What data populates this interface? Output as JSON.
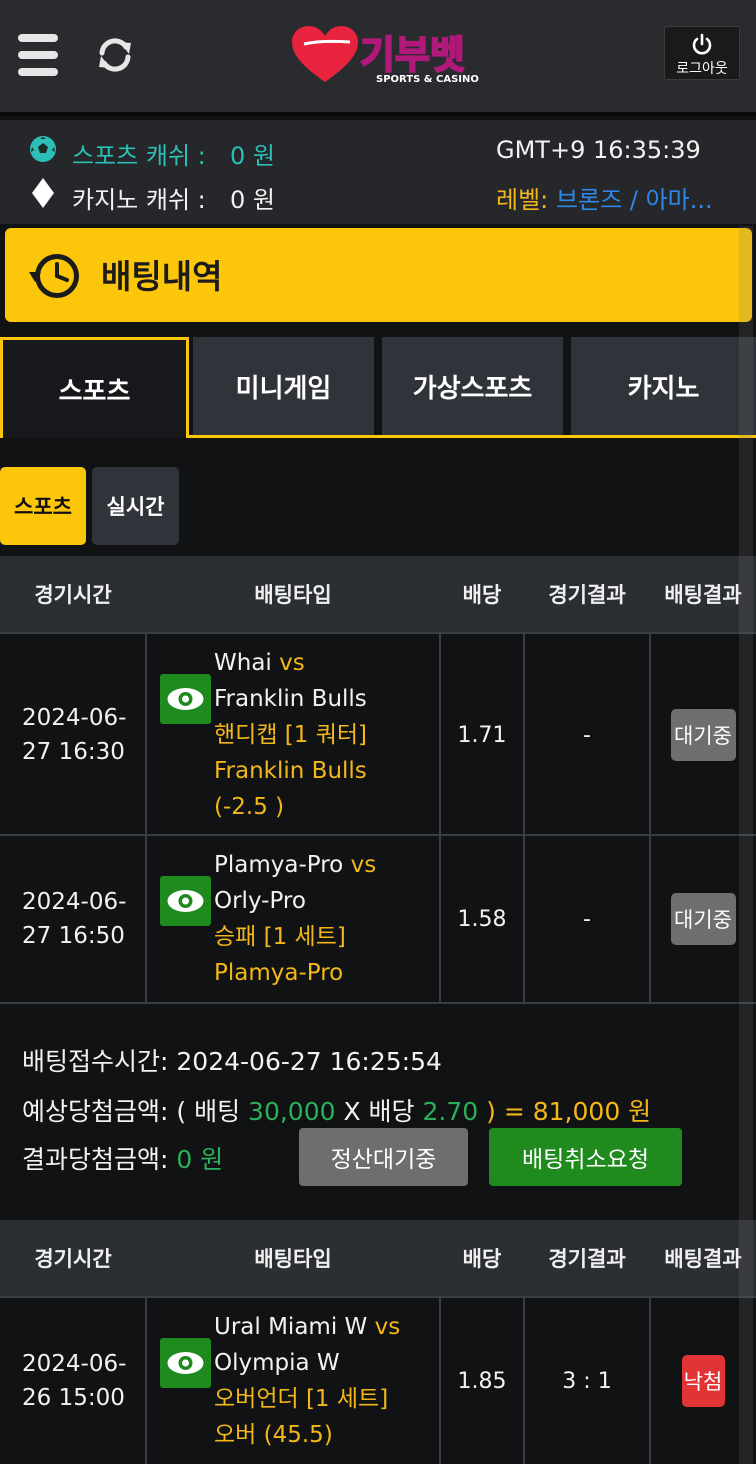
{
  "header": {
    "logo_text": "기부벳",
    "logo_sub": "SPORTS & CASINO",
    "logout_label": "로그아웃"
  },
  "balance": {
    "sports_label": "스포츠 캐쉬 :",
    "sports_value": "0 원",
    "casino_label": "카지노 캐쉬 :",
    "casino_value": "0 원",
    "clock": "GMT+9 16:35:39",
    "level_label": "레벨:",
    "level_value": "브론즈 / 아마..."
  },
  "page_title": "배팅내역",
  "tabs": [
    "스포츠",
    "미니게임",
    "가상스포츠",
    "카지노"
  ],
  "subtabs": [
    "스포츠",
    "실시간"
  ],
  "table_headers": [
    "경기시간",
    "배팅타입",
    "배당",
    "경기결과",
    "배팅결과"
  ],
  "bets": [
    {
      "rows": [
        {
          "date1": "2024-06-",
          "date2": "27 16:30",
          "team1": "Whai",
          "vs": "vs",
          "team2": "Franklin Bulls",
          "market": "핸디캡 [1 쿼터]",
          "pick1": "Franklin Bulls",
          "pick2": "(-2.5 )",
          "odds": "1.71",
          "result": "-",
          "status": "대기중"
        },
        {
          "date1": "2024-06-",
          "date2": "27 16:50",
          "team1": "Plamya-Pro",
          "vs": "vs",
          "team2": "Orly-Pro",
          "market": "승패 [1 세트]",
          "pick1": "Plamya-Pro",
          "odds": "1.58",
          "result": "-",
          "status": "대기중"
        }
      ],
      "summary": {
        "time_label": "배팅접수시간:",
        "time_value": "2024-06-27 16:25:54",
        "expect_label": "예상당첨금액:",
        "expect_open": "( 배팅",
        "stake": "30,000",
        "times": "X 배당",
        "total_odds": "2.70",
        "expect_close": ") =",
        "payout": "81,000 원",
        "result_label": "결과당첨금액:",
        "result_value": "0 원",
        "btn_settle": "정산대기중",
        "btn_cancel": "배팅취소요청"
      }
    },
    {
      "rows": [
        {
          "date1": "2024-06-",
          "date2": "26 15:00",
          "team1": "Ural Miami W",
          "vs": "vs",
          "team2": "Olympia W",
          "market": "오버언더 [1 세트]",
          "pick1": "오버 (45.5)",
          "odds": "1.85",
          "result": "3 : 1",
          "status": "낙첨"
        }
      ]
    }
  ],
  "colors": {
    "accent": "#fcc60b",
    "cyan": "#2bbfb5",
    "gold": "#f3b71a",
    "green": "#2bb05a",
    "blue": "#2d88e8",
    "lose": "#e13434"
  }
}
